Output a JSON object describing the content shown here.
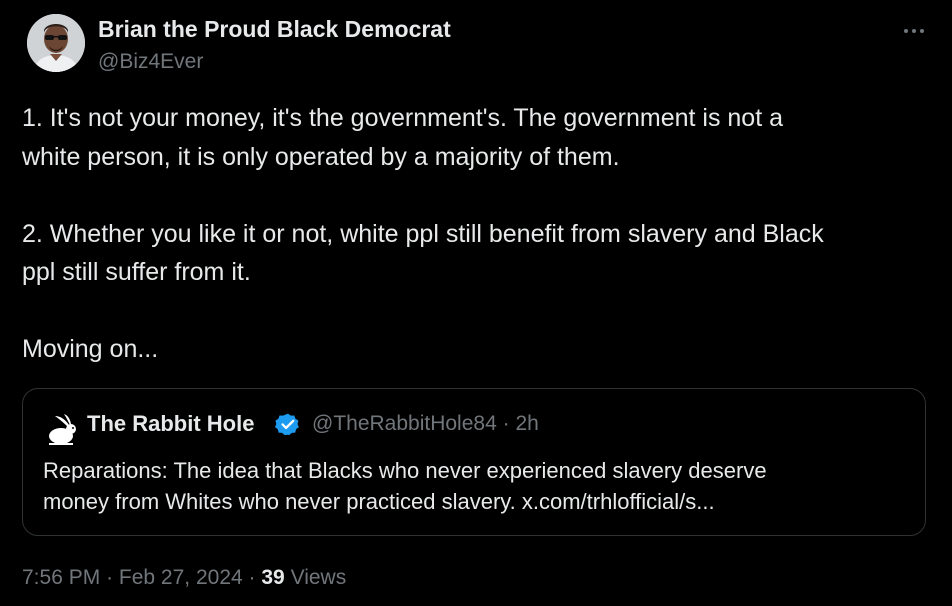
{
  "colors": {
    "background": "#000000",
    "primary_text": "#e7e9ea",
    "secondary_text": "#71767b",
    "border": "#2f3336",
    "verified_badge": "#1d9bf0"
  },
  "author": {
    "display_name": "Brian the Proud Black Democrat",
    "handle": "@Biz4Ever",
    "avatar_icon": "profile-photo"
  },
  "more_icon": "more-horizontal-icon",
  "tweet": {
    "lines": [
      "1. It's not your money, it's the government's. The government is not a",
      "white person, it is only operated by a majority of them.",
      "",
      "2. Whether you like it or not, white ppl still benefit from slavery and Black",
      "ppl still suffer from it.",
      "",
      "Moving on..."
    ]
  },
  "quote": {
    "display_name": "The Rabbit Hole",
    "verified_icon": "verified-badge-icon",
    "avatar_icon": "rabbit-logo-icon",
    "handle": "@TheRabbitHole84",
    "separator": "·",
    "time": "2h",
    "lines": [
      "Reparations: The idea that Blacks who never experienced slavery deserve",
      "money from Whites who never practiced slavery. x.com/trhlofficial/s..."
    ]
  },
  "meta": {
    "time": "7:56 PM",
    "separator1": "·",
    "date": "Feb 27, 2024",
    "separator2": "·",
    "views_count": "39",
    "views_label": "Views"
  }
}
